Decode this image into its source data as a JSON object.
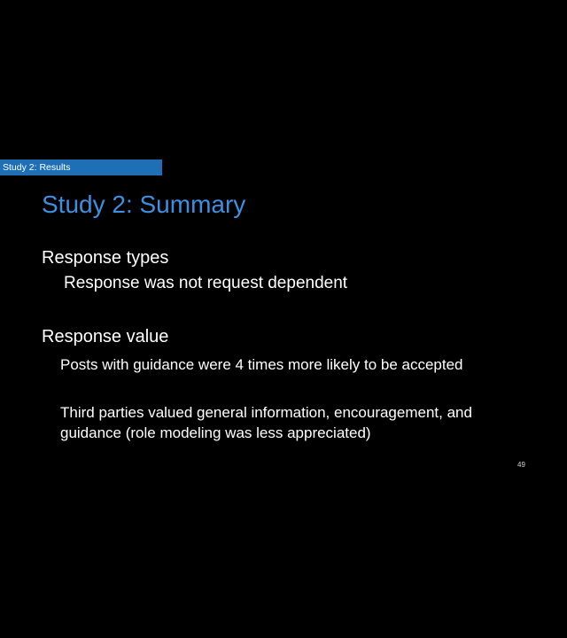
{
  "section_tag": "Study 2: Results",
  "title": "Study 2: Summary",
  "sections": [
    {
      "heading": "Response types",
      "items": [
        "Response was not request dependent"
      ]
    },
    {
      "heading": "Response value",
      "items": [
        "Posts with guidance were 4 times more likely to be accepted",
        "Third parties valued general information, encouragement, and guidance (role modeling was less appreciated)"
      ]
    }
  ],
  "slide_number": "49",
  "colors": {
    "background": "#000000",
    "accent_bar": "#1f6fb7",
    "title": "#3d8fe0",
    "text": "#ffffff"
  }
}
